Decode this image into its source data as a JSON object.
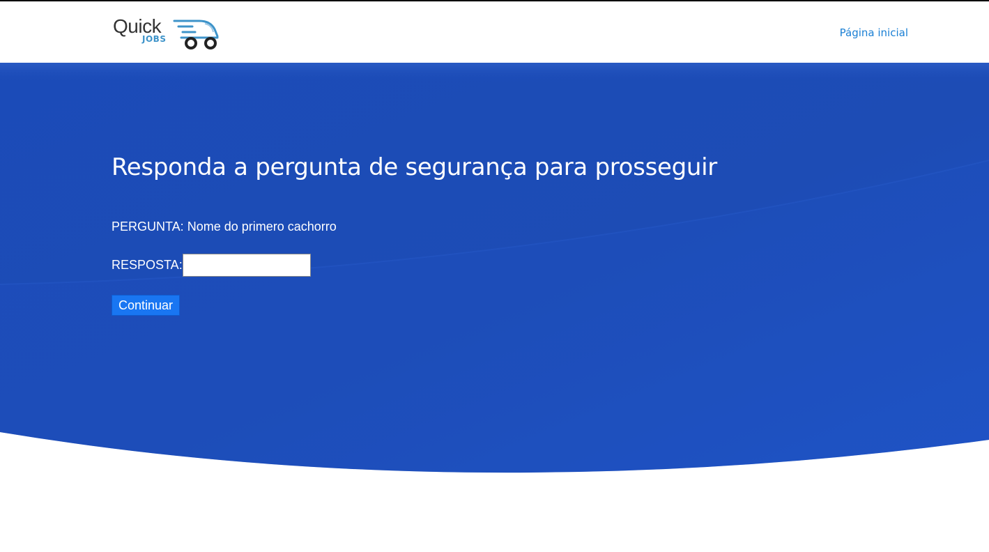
{
  "header": {
    "logo_main": "Quick",
    "logo_sub": "JOBS",
    "nav_home": "Página inicial"
  },
  "main": {
    "title": "Responda a pergunta de segurança para prosseguir",
    "question_label": "PERGUNTA:",
    "question_text": "Nome do primero cachorro",
    "answer_label": "RESPOSTA:",
    "answer_value": "",
    "continue_label": "Continuar"
  },
  "colors": {
    "hero_blue": "#1c4fbf",
    "link": "#1a7fd4",
    "button": "#1976f2"
  }
}
